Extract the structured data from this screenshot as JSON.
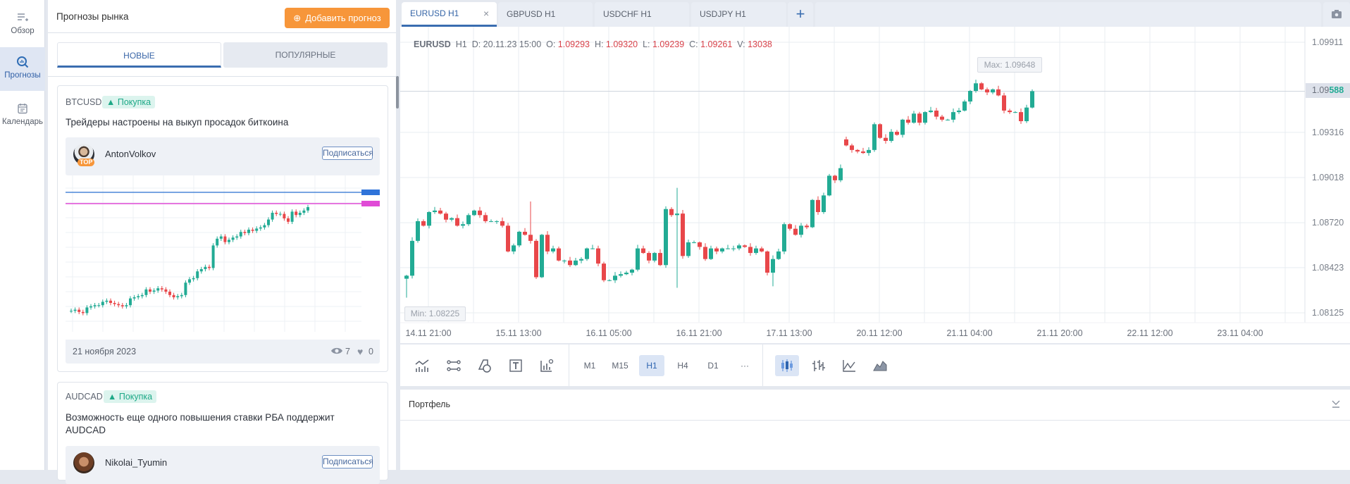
{
  "sidebar": {
    "items": [
      {
        "label": "Обзор",
        "icon": "overview-add-icon"
      },
      {
        "label": "Прогнозы",
        "icon": "forecast-search-icon",
        "active": true
      },
      {
        "label": "Календарь",
        "icon": "calendar-icon"
      }
    ]
  },
  "left_panel": {
    "title": "Прогнозы рынка",
    "add_button": "Добавить прогноз",
    "tabs": [
      {
        "label": "НОВЫЕ",
        "active": true
      },
      {
        "label": "ПОПУЛЯРНЫЕ"
      }
    ],
    "cards": [
      {
        "symbol": "BTCUSD",
        "direction": "Покупка",
        "title": "Трейдеры настроены на выкуп просадок биткоина",
        "author": "AntonVolkov",
        "author_badge": "TOP",
        "subscribe": "Подписаться",
        "date": "21 ноября 2023",
        "views": "7",
        "likes": "0",
        "preview_closes": [
          8,
          9,
          7,
          6,
          11,
          12,
          13,
          13,
          16,
          17,
          15,
          14,
          13,
          12,
          13,
          19,
          20,
          21,
          22,
          27,
          25,
          26,
          28,
          27,
          25,
          22,
          20,
          21,
          22,
          33,
          36,
          37,
          43,
          45,
          47,
          46,
          66,
          72,
          74,
          69,
          71,
          73,
          74,
          78,
          77,
          80,
          79,
          81,
          82,
          84,
          89,
          95,
          94,
          94,
          90,
          87,
          96,
          93,
          95,
          97,
          100
        ]
      },
      {
        "symbol": "AUDCAD",
        "direction": "Покупка",
        "title": "Возможность еще одного повышения ставки РБА поддержит AUDCAD",
        "author": "Nikolai_Tyumin",
        "subscribe": "Подписаться"
      }
    ]
  },
  "chart_tabs": [
    {
      "label": "EURUSD H1",
      "active": true
    },
    {
      "label": "GBPUSD H1"
    },
    {
      "label": "USDCHF H1"
    },
    {
      "label": "USDJPY H1"
    }
  ],
  "chart": {
    "symbol": "EURUSD",
    "timeframe": "H1",
    "ohlc": {
      "d_label": "D:",
      "date": "20.11.23 15:00",
      "o_label": "O:",
      "o": "1.09293",
      "h_label": "H:",
      "h": "1.09320",
      "l_label": "L:",
      "l": "1.09239",
      "c_label": "C:",
      "c": "1.09261",
      "v_label": "V:",
      "v": "13038"
    },
    "price_ticks": [
      "1.09911",
      "1.09316",
      "1.09018",
      "1.08720",
      "1.08423",
      "1.08125"
    ],
    "current_price": {
      "prefix": "1.09",
      "suffix": "588",
      "value": 1.09588
    },
    "max_label": "Max: 1.09648",
    "max_value": 1.09648,
    "min_label": "Min: 1.08225",
    "min_value": 1.08225,
    "time_labels": [
      "14.11 21:00",
      "15.11 13:00",
      "16.11 05:00",
      "16.11 21:00",
      "17.11 13:00",
      "20.11 12:00",
      "21.11 04:00",
      "21.11 20:00",
      "22.11 12:00",
      "23.11 04:00"
    ],
    "first_open": 1.0835,
    "gap_opens": {
      "78": 1.0927
    },
    "closes": [
      1.0837,
      1.086,
      1.0873,
      1.087,
      1.0879,
      1.088,
      1.0878,
      1.0874,
      1.0875,
      1.087,
      1.0871,
      1.0877,
      1.088,
      1.0877,
      1.0873,
      1.0873,
      1.0873,
      1.087,
      1.0853,
      1.0857,
      1.0866,
      1.0864,
      1.086,
      1.0836,
      1.0864,
      1.0853,
      1.0855,
      1.0847,
      1.0847,
      1.0844,
      1.0847,
      1.0848,
      1.0855,
      1.0855,
      1.0845,
      1.0834,
      1.0834,
      1.0837,
      1.0838,
      1.0839,
      1.0841,
      1.0855,
      1.0852,
      1.0847,
      1.0852,
      1.0844,
      1.0881,
      1.0877,
      1.0878,
      1.085,
      1.0859,
      1.0859,
      1.0856,
      1.0848,
      1.0855,
      1.0853,
      1.0855,
      1.0855,
      1.0855,
      1.0857,
      1.0856,
      1.0852,
      1.0855,
      1.0853,
      1.0839,
      1.0848,
      1.0853,
      1.0871,
      1.0868,
      1.0864,
      1.087,
      1.0869,
      1.0887,
      1.0879,
      1.089,
      1.0903,
      1.09,
      1.0908,
      1.0923,
      1.092,
      1.0919,
      1.0918,
      1.092,
      1.0937,
      1.0928,
      1.0926,
      1.0932,
      1.093,
      1.094,
      1.0938,
      1.0944,
      1.0938,
      1.0945,
      1.0946,
      1.0942,
      1.094,
      1.094,
      1.0945,
      1.0946,
      1.0952,
      1.0959,
      1.0964,
      1.096,
      1.0958,
      1.096,
      1.0956,
      1.0946,
      1.0945,
      1.0945,
      1.0939,
      1.0948,
      1.09588
    ],
    "colors": {
      "up": "#22ab94",
      "down": "#e8474a",
      "grid": "#e8edf2"
    }
  },
  "toolbar": {
    "timeframes": [
      "M1",
      "M15",
      "H1",
      "H4",
      "D1",
      "···"
    ],
    "active_timeframe": "H1"
  },
  "portfolio": {
    "title": "Портфель"
  }
}
